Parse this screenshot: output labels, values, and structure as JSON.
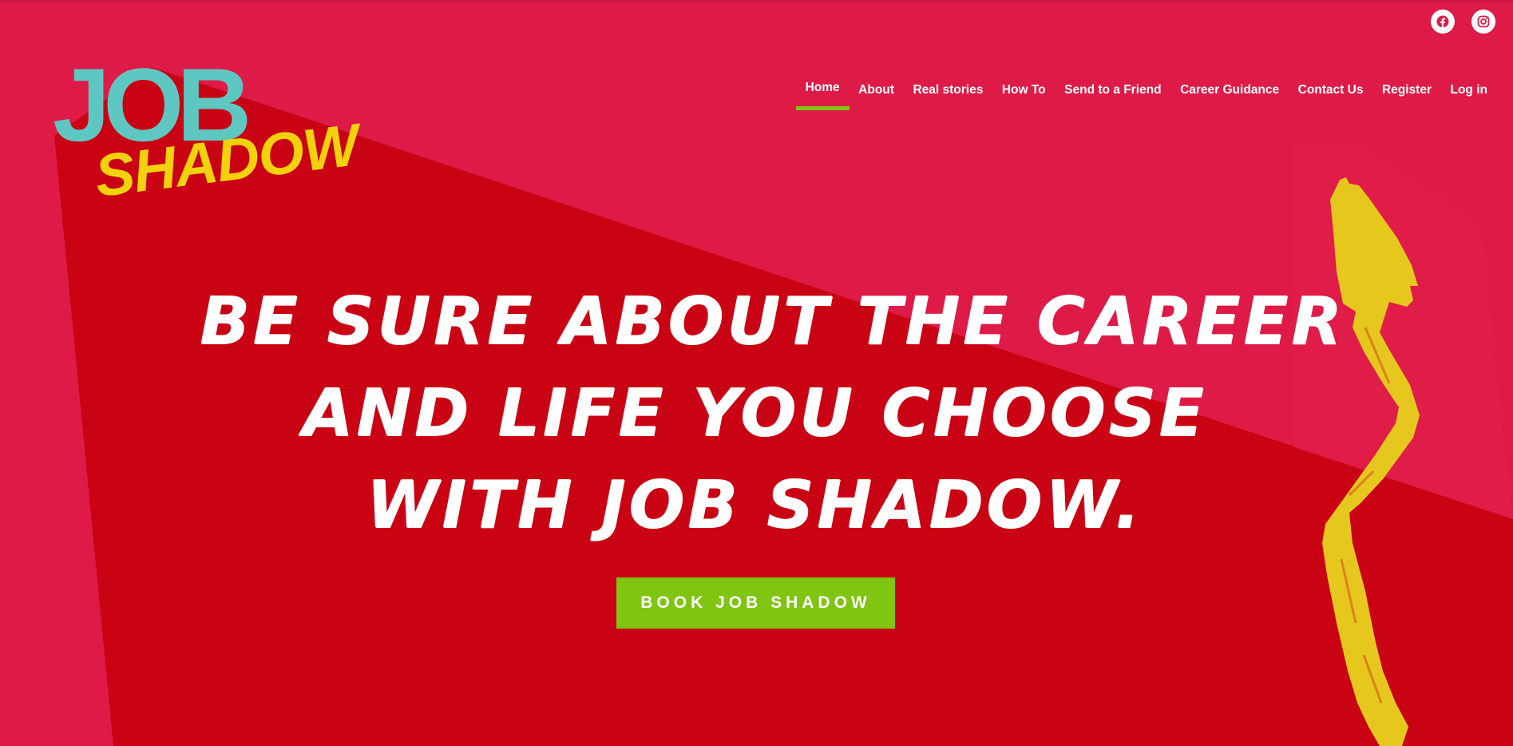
{
  "colors": {
    "background_pink": "#de1b47",
    "beam_red": "#c90314",
    "nav_underline": "#7fc511",
    "button_green": "#7fc511",
    "logo_teal": "#5fc7c2",
    "logo_yellow": "#f4d20b",
    "figure_yellow": "#e6c71e"
  },
  "social": [
    {
      "icon": "facebook-icon",
      "glyph": "f"
    },
    {
      "icon": "instagram-icon",
      "glyph": ""
    }
  ],
  "logo": {
    "line1": "JOB",
    "line2": "SHADOW"
  },
  "nav": {
    "items": [
      {
        "label": "Home",
        "active": true
      },
      {
        "label": "About",
        "active": false
      },
      {
        "label": "Real stories",
        "active": false
      },
      {
        "label": "How To",
        "active": false
      },
      {
        "label": "Send to a Friend",
        "active": false
      },
      {
        "label": "Career Guidance",
        "active": false
      },
      {
        "label": "Contact Us",
        "active": false
      },
      {
        "label": "Register",
        "active": false
      },
      {
        "label": "Log in",
        "active": false
      }
    ]
  },
  "hero": {
    "line1": "BE SURE ABOUT THE CAREER",
    "line2": "AND LIFE YOU CHOOSE",
    "line3": "WITH JOB SHADOW."
  },
  "cta": {
    "label": "BOOK JOB SHADOW"
  }
}
